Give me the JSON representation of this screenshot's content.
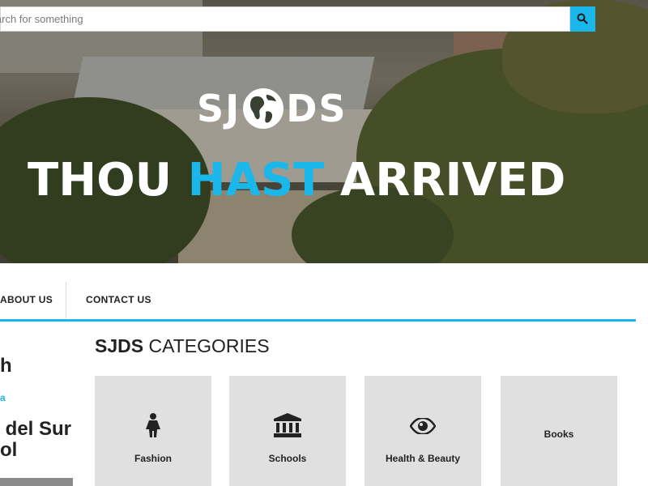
{
  "search": {
    "placeholder": "Search for something"
  },
  "hero": {
    "logo_left": "SJ",
    "logo_right": "DS",
    "headline_part1": "THOU ",
    "headline_accent": "HAST",
    "headline_part2": " ARRIVED"
  },
  "nav": {
    "items": [
      {
        "label": "ABOUT US"
      },
      {
        "label": "CONTACT US"
      }
    ]
  },
  "sidebar": {
    "heading_fragment": "h",
    "link_fragment": "a",
    "title_fragment": " del Sur\nol"
  },
  "categories": {
    "title_bold": "SJDS",
    "title_rest": " CATEGORIES",
    "items": [
      {
        "label": "Fashion",
        "icon": "female-person-icon"
      },
      {
        "label": "Schools",
        "icon": "institution-icon"
      },
      {
        "label": "Health & Beauty",
        "icon": "eye-icon"
      },
      {
        "label": "Books",
        "icon": ""
      }
    ]
  },
  "colors": {
    "accent": "#1ab7ea",
    "card_bg": "#e0e0e0",
    "text": "#222222"
  }
}
